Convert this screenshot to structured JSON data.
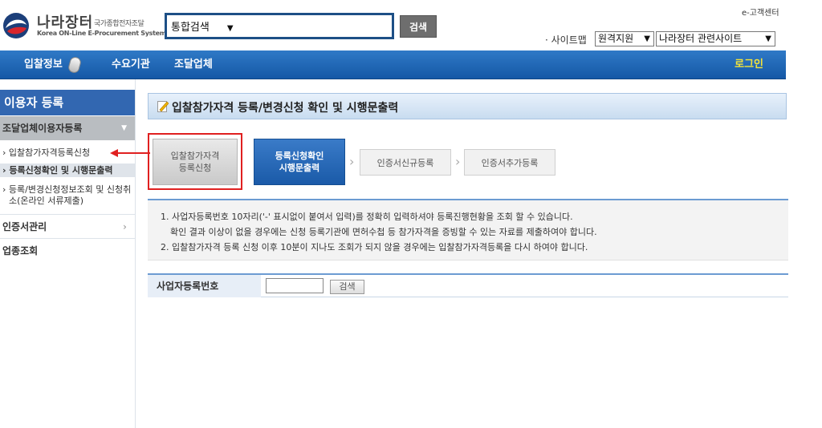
{
  "header": {
    "logo_title": "나라장터",
    "logo_sub": "국가종합전자조달",
    "logo_en": "Korea ON-Line E-Procurement System",
    "search_select": "통합검색",
    "search_button": "검색",
    "cs_link": "e-고객센터",
    "sitemap": "· 사이트맵",
    "remote_select": "원격지원",
    "related_select": "나라장터 관련사이트"
  },
  "nav": {
    "items": [
      "입찰정보",
      "수요기관",
      "조달업체"
    ],
    "login": "로그인"
  },
  "sidebar": {
    "title": "이용자 등록",
    "group": "조달업체이용자등록",
    "subs": [
      "› 입찰참가자격등록신청",
      "› 등록신청확인 및 시행문출력",
      "› 등록/변경신청정보조회 및 신청취",
      "소(온라인 서류제출)"
    ],
    "menus": [
      "인증서관리",
      "업종조회"
    ]
  },
  "content": {
    "title": "입찰참가자격 등록/변경신청 확인 및 시행문출력",
    "steps": {
      "step1_line1": "입찰참가자격",
      "step1_line2": "등록신청",
      "step2_line1": "등록신청확인",
      "step2_line2": "시행문출력",
      "step3": "인증서신규등록",
      "step4": "인증서추가등록"
    },
    "notice": [
      "1. 사업자등록번호 10자리('-' 표시없이 붙여서 입력)를 정확히 입력하셔야 등록진행현황을 조회 할 수 있습니다.",
      "확인 결과 이상이 없을 경우에는 신청 등록기관에 면허수첩 등 참가자격을 증빙할 수 있는 자료를 제출하여야 합니다.",
      "2. 입찰참가자격 등록 신청 이후 10분이 지나도 조회가 되지 않을 경우에는 입찰참가자격등록을 다시 하여야 합니다."
    ],
    "bizno_label": "사업자등록번호",
    "bizno_value": "",
    "bizno_button": "검색"
  },
  "colors": {
    "nav_blue": "#1f66b5",
    "sidebar_title": "#3267b1",
    "login_yellow": "#f3e33a",
    "highlight_red": "#e02020"
  }
}
